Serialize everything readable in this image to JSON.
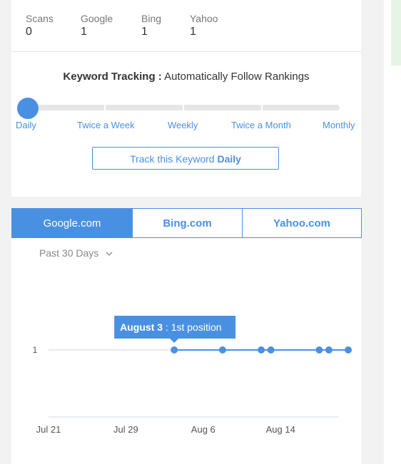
{
  "stats": [
    {
      "label": "Scans",
      "value": "0"
    },
    {
      "label": "Google",
      "value": "1"
    },
    {
      "label": "Bing",
      "value": "1"
    },
    {
      "label": "Yahoo",
      "value": "1"
    }
  ],
  "tracking": {
    "title_bold": "Keyword Tracking :",
    "title_rest": " Automatically Follow Rankings",
    "frequencies": [
      "Daily",
      "Twice a Week",
      "Weekly",
      "Twice a Month",
      "Monthly"
    ],
    "selected": "Daily",
    "button_prefix": "Track this Keyword ",
    "button_bold": "Daily"
  },
  "engines": {
    "tabs": [
      "Google.com",
      "Bing.com",
      "Yahoo.com"
    ],
    "active": "Google.com"
  },
  "period": {
    "label": "Past 30 Days",
    "icon": "chevron-down-icon"
  },
  "chart_data": {
    "type": "line",
    "x_ticks": [
      "Jul 21",
      "Jul 29",
      "Aug 6",
      "Aug 14"
    ],
    "y_ticks": [
      "1"
    ],
    "series": [
      {
        "points": [
          {
            "x": "Aug 3",
            "y": 1
          },
          {
            "x": "Aug 8",
            "y": 1
          },
          {
            "x": "Aug 12",
            "y": 1
          },
          {
            "x": "Aug 13",
            "y": 1
          },
          {
            "x": "Aug 18",
            "y": 1
          },
          {
            "x": "Aug 19",
            "y": 1
          },
          {
            "x": "Aug 21",
            "y": 1
          }
        ]
      }
    ],
    "tooltip": {
      "date": "August 3",
      "sep": " : ",
      "value": "1st position"
    },
    "colors": {
      "line": "#4a90e2",
      "grid": "#d6d6d6",
      "tooltip": "#4a90e2"
    }
  },
  "colors": {
    "accent": "#4a90e2",
    "knob": "#4a90e2"
  }
}
